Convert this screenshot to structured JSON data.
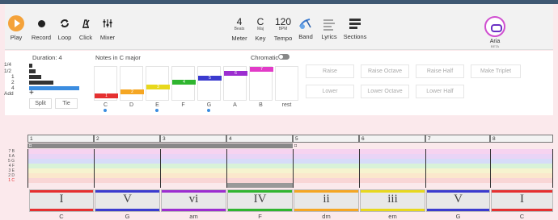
{
  "toolbar": {
    "play": "Play",
    "record": "Record",
    "loop": "Loop",
    "click": "Click",
    "mixer": "Mixer",
    "beats_value": "4",
    "beats_unit": "Beats",
    "meter": "Meter",
    "key_value": "C",
    "key_unit": "Maj",
    "key": "Key",
    "tempo_value": "120",
    "tempo_unit": "BPM",
    "tempo": "Tempo",
    "band": "Band",
    "lyrics": "Lyrics",
    "sections": "Sections",
    "aria": "Aria",
    "aria_sub": "BETA"
  },
  "duration": {
    "label": "Duration: 4",
    "rows": [
      "1/4",
      "1/2",
      "1",
      "2",
      "4",
      "Add"
    ],
    "split": "Split",
    "tie": "Tie",
    "add_glyph": "+"
  },
  "notes": {
    "label": "Notes in C major",
    "chromatic": "Chromatic",
    "items": [
      {
        "name": "C",
        "degree": "1",
        "color": "#e53030"
      },
      {
        "name": "D",
        "degree": "2",
        "color": "#f5a623"
      },
      {
        "name": "E",
        "degree": "3",
        "color": "#e8d81c"
      },
      {
        "name": "F",
        "degree": "4",
        "color": "#2fb52f"
      },
      {
        "name": "G",
        "degree": "5",
        "color": "#3b3bcf"
      },
      {
        "name": "A",
        "degree": "6",
        "color": "#9c2dd0"
      },
      {
        "name": "B",
        "degree": "7",
        "color": "#e23bc8"
      },
      {
        "name": "rest",
        "degree": "",
        "color": ""
      }
    ]
  },
  "actions": {
    "raise": "Raise",
    "raise_octave": "Raise Octave",
    "raise_half": "Raise Half",
    "make_triplet": "Make Triplet",
    "lower": "Lower",
    "lower_octave": "Lower Octave",
    "lower_half": "Lower Half"
  },
  "measures": [
    "1",
    "2",
    "3",
    "4",
    "5",
    "6",
    "7",
    "8"
  ],
  "row_labels": [
    "7 B",
    "6 A",
    "5 G",
    "4 F",
    "3 E",
    "2 D",
    "1 C"
  ],
  "chords": [
    {
      "numeral": "I",
      "name": "C",
      "color": "#e53030"
    },
    {
      "numeral": "V",
      "name": "G",
      "color": "#3b3bcf"
    },
    {
      "numeral": "vi",
      "name": "am",
      "color": "#9c2dd0"
    },
    {
      "numeral": "IV",
      "name": "F",
      "color": "#2fb52f"
    },
    {
      "numeral": "ii",
      "name": "dm",
      "color": "#f5a623"
    },
    {
      "numeral": "iii",
      "name": "em",
      "color": "#e8d81c"
    },
    {
      "numeral": "V",
      "name": "G",
      "color": "#3b3bcf"
    },
    {
      "numeral": "I",
      "name": "C",
      "color": "#e53030"
    }
  ]
}
